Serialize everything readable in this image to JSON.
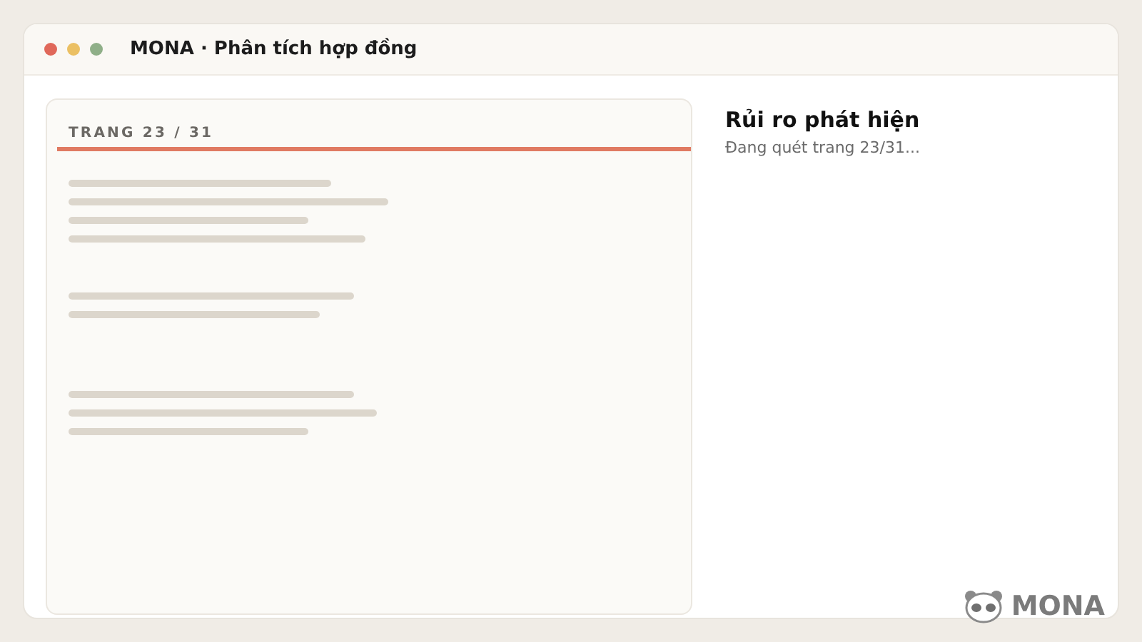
{
  "window": {
    "title": "MONA · Phân tích hợp đồng"
  },
  "document": {
    "page_label": "TRANG 23 / 31"
  },
  "risks": {
    "title": "Rủi ro phát hiện",
    "status": "Đang quét trang 23/31..."
  },
  "logo": {
    "text": "MONA"
  }
}
